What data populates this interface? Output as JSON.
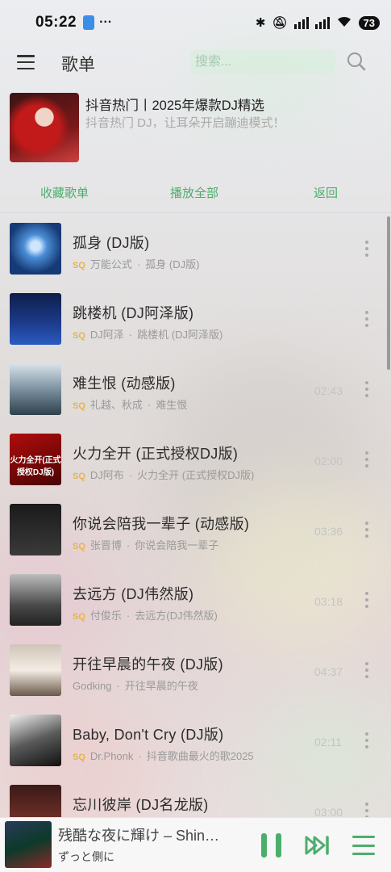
{
  "status_bar": {
    "time": "05:22",
    "more": "···",
    "battery": "73"
  },
  "header": {
    "title": "歌单",
    "search_placeholder": "搜索..."
  },
  "playlist": {
    "title": "抖音热门丨2025年爆款DJ精选",
    "description": "抖音热门 DJ，让耳朵开启蹦迪模式！"
  },
  "actions": {
    "collect": "收藏歌单",
    "play_all": "播放全部",
    "back": "返回"
  },
  "songs": [
    {
      "title": "孤身 (DJ版)",
      "quality": "SQ",
      "artist": "万能公式",
      "album": "孤身 (DJ版)",
      "duration": ""
    },
    {
      "title": "跳楼机 (DJ阿泽版)",
      "quality": "SQ",
      "artist": "DJ阿泽",
      "album": "跳楼机 (DJ阿泽版)",
      "duration": ""
    },
    {
      "title": "难生恨 (动感版)",
      "quality": "SQ",
      "artist": "礼越、秋成",
      "album": "难生恨",
      "duration": "02:43"
    },
    {
      "title": "火力全开 (正式授权DJ版)",
      "quality": "SQ",
      "artist": "DJ阿布",
      "album": "火力全开 (正式授权DJ版)",
      "duration": "02:00",
      "cover_text": "火力全开(正式授权DJ版)"
    },
    {
      "title": "你说会陪我一辈子 (动感版)",
      "quality": "SQ",
      "artist": "张晋博",
      "album": "你说会陪我一辈子",
      "duration": "03:36"
    },
    {
      "title": "去远方 (DJ伟然版)",
      "quality": "SQ",
      "artist": "付俊乐",
      "album": "去远方(DJ伟然版)",
      "duration": "03:18"
    },
    {
      "title": "开往早晨的午夜 (DJ版)",
      "quality": "",
      "artist": "Godking",
      "album": "开往早晨的午夜",
      "duration": "04:37"
    },
    {
      "title": "Baby, Don't Cry (DJ版)",
      "quality": "SQ",
      "artist": "Dr.Phonk",
      "album": "抖音歌曲最火的歌2025",
      "duration": "02:11"
    },
    {
      "title": "忘川彼岸 (DJ名龙版)",
      "quality": "SQ",
      "artist": "",
      "album": "",
      "duration": "03:00"
    }
  ],
  "now_playing": {
    "title": "残酷な夜に輝け – Shin…",
    "artist": "ずっと側に"
  },
  "colors": {
    "accent": "#4cae6c",
    "sq_badge": "#e8b34a"
  }
}
